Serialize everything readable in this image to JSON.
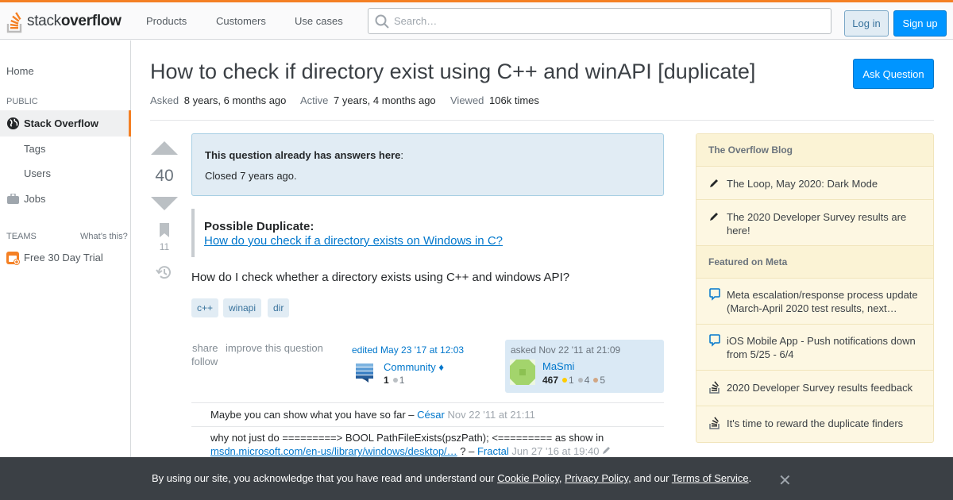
{
  "header": {
    "logo_prefix": "stack",
    "logo_bold": "overflow",
    "nav": [
      "Products",
      "Customers",
      "Use cases"
    ],
    "search_placeholder": "Search…",
    "login_label": "Log in",
    "signup_label": "Sign up"
  },
  "sidebar_left": {
    "home": "Home",
    "public_label": "PUBLIC",
    "stack_overflow": "Stack Overflow",
    "tags": "Tags",
    "users": "Users",
    "jobs": "Jobs",
    "teams_label": "TEAMS",
    "whats_this": "What’s this?",
    "free_trial": "Free 30 Day Trial"
  },
  "question": {
    "title": "How to check if directory exist using C++ and winAPI [duplicate]",
    "ask_button": "Ask Question",
    "asked_label": "Asked",
    "asked_value": "8 years, 6 months ago",
    "active_label": "Active",
    "active_value": "7 years, 4 months ago",
    "viewed_label": "Viewed",
    "viewed_value": "106k times",
    "votes": "40",
    "bookmarks": "11",
    "duplicate_notice": "This question already has answers here",
    "duplicate_colon": ":",
    "closed_text": "Closed 7 years ago.",
    "possible_duplicate": "Possible Duplicate:",
    "duplicate_link": "How do you check if a directory exists on Windows in C?",
    "body": "How do I check whether a directory exists using C++ and windows API?",
    "tags": [
      "c++",
      "winapi",
      "dir"
    ]
  },
  "post_menu": {
    "share": "share",
    "improve": "improve this question",
    "follow": "follow"
  },
  "editor": {
    "edited": "edited May 23 '17 at 12:03",
    "name": "Community",
    "diamond": "♦",
    "rep": "1",
    "silver": "1"
  },
  "owner": {
    "asked": "asked Nov 22 '11 at 21:09",
    "name": "MaSmi",
    "rep": "467",
    "gold": "1",
    "silver": "4",
    "bronze": "5"
  },
  "comments": [
    {
      "text": "Maybe you can show what you have so far –",
      "user": "César",
      "date": "Nov 22 '11 at 21:11"
    },
    {
      "text_line1": "why not just do =========> BOOL PathFileExists(pszPath); <========= as show in",
      "link": "msdn.microsoft.com/en-us/library/windows/desktop/…",
      "mid": " ? –",
      "user": "Fractal",
      "date": "Jun 27 '16 at 19:40"
    }
  ],
  "sidebar_right": {
    "blog_header": "The Overflow Blog",
    "blog_items": [
      "The Loop, May 2020: Dark Mode",
      "The 2020 Developer Survey results are here!"
    ],
    "meta_header": "Featured on Meta",
    "meta_items": [
      "Meta escalation/response process update (March-April 2020 test results, next…",
      "iOS Mobile App - Push notifications down from 5/25 - 6/4",
      "2020 Developer Survey results feedback",
      "It's time to reward the duplicate finders"
    ]
  },
  "cookie": {
    "prefix": "By using our site, you acknowledge that you have read and understand our",
    "cookie_policy": "Cookie Policy",
    "comma1": ",",
    "privacy_policy": "Privacy Policy",
    "and_our": ", and our",
    "terms": "Terms of Service",
    "period": ".",
    "close": "✕"
  },
  "colors": {
    "accent": "#f48024",
    "link": "#0077cc",
    "button_blue": "#0095ff",
    "tag_bg": "#e1ecf4",
    "sidebar_bg": "#fdf7e2",
    "banner_bg": "#3b4045"
  }
}
